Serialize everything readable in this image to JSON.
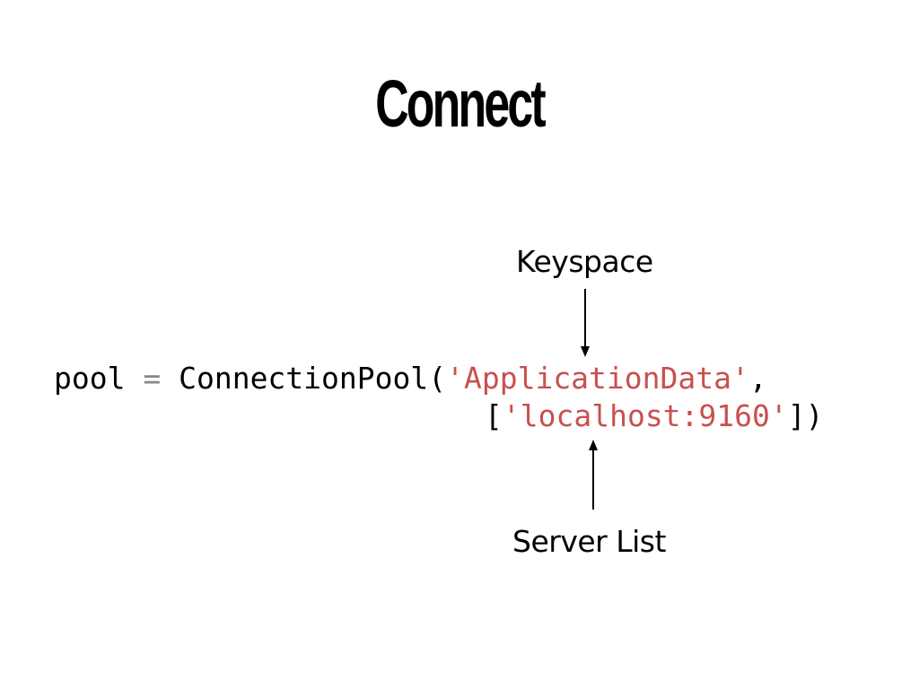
{
  "slide": {
    "title": "Connect"
  },
  "annotations": {
    "keyspace": "Keyspace",
    "server_list": "Server List"
  },
  "code": {
    "line1": {
      "var": "pool",
      "op": " = ",
      "call": "ConnectionPool(",
      "arg1": "'ApplicationData'",
      "trailing": ","
    },
    "line2": {
      "open": "[",
      "arg2": "'localhost:9160'",
      "close": "])"
    }
  },
  "colors": {
    "string": "#c8504f",
    "operator": "#888888",
    "text": "#000000",
    "background": "#ffffff"
  }
}
